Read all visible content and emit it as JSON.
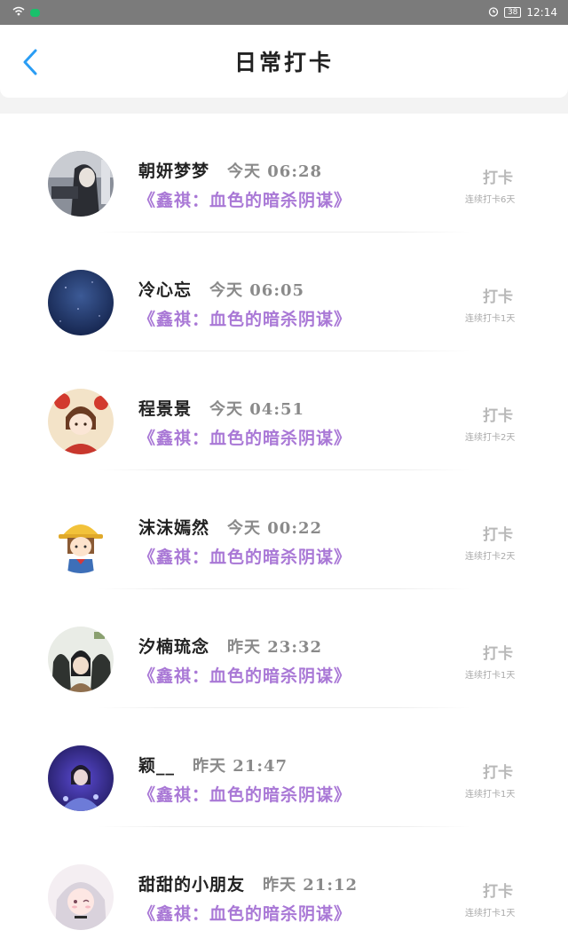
{
  "status_bar": {
    "time": "12:14",
    "battery": "38",
    "icons": [
      "wifi-icon",
      "wechat-icon",
      "alarm-icon",
      "battery-icon"
    ]
  },
  "header": {
    "title": "日常打卡",
    "back_icon": "chevron-left-icon",
    "accent_color": "#2a9df4"
  },
  "colors": {
    "book_title": "#a978d6",
    "name": "#222222",
    "time": "#8a8a8a",
    "checkin": "#b8b8b8"
  },
  "entries": [
    {
      "name": "朝妍梦梦",
      "time": "今天 06:28",
      "book": "《鑫祺：血色的暗杀阴谋》",
      "button": "打卡",
      "streak": "连续打卡6天"
    },
    {
      "name": "冷心忘",
      "time": "今天 06:05",
      "book": "《鑫祺：血色的暗杀阴谋》",
      "button": "打卡",
      "streak": "连续打卡1天"
    },
    {
      "name": "程景景",
      "time": "今天 04:51",
      "book": "《鑫祺：血色的暗杀阴谋》",
      "button": "打卡",
      "streak": "连续打卡2天"
    },
    {
      "name": "沫沫嫣然",
      "time": "今天 00:22",
      "book": "《鑫祺：血色的暗杀阴谋》",
      "button": "打卡",
      "streak": "连续打卡2天"
    },
    {
      "name": "汐楠琉念",
      "time": "昨天 23:32",
      "book": "《鑫祺：血色的暗杀阴谋》",
      "button": "打卡",
      "streak": "连续打卡1天"
    },
    {
      "name": "颖__",
      "time": "昨天 21:47",
      "book": "《鑫祺：血色的暗杀阴谋》",
      "button": "打卡",
      "streak": "连续打卡1天"
    },
    {
      "name": "甜甜的小朋友",
      "time": "昨天 21:12",
      "book": "《鑫祺：血色的暗杀阴谋》",
      "button": "打卡",
      "streak": "连续打卡1天"
    }
  ]
}
